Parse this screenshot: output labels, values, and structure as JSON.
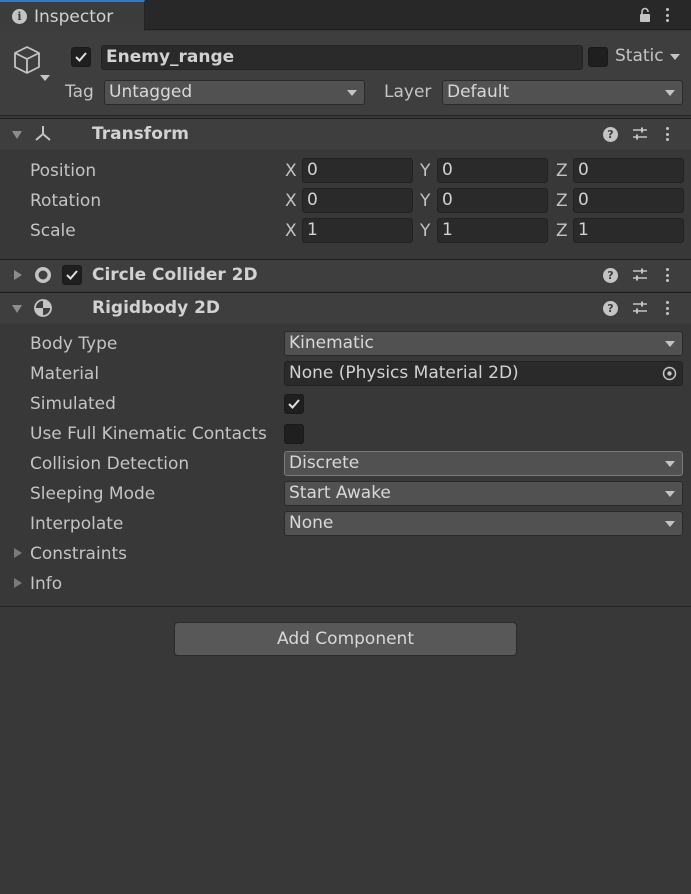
{
  "tab": {
    "title": "Inspector"
  },
  "gameobject": {
    "active": true,
    "name": "Enemy_range",
    "static_label": "Static",
    "tag_label": "Tag",
    "tag_value": "Untagged",
    "layer_label": "Layer",
    "layer_value": "Default"
  },
  "transform": {
    "title": "Transform",
    "rows": [
      {
        "label": "Position",
        "x": "0",
        "y": "0",
        "z": "0"
      },
      {
        "label": "Rotation",
        "x": "0",
        "y": "0",
        "z": "0"
      },
      {
        "label": "Scale",
        "x": "1",
        "y": "1",
        "z": "1"
      }
    ],
    "axis": {
      "x": "X",
      "y": "Y",
      "z": "Z"
    }
  },
  "circle_collider": {
    "title": "Circle Collider 2D",
    "enabled": true,
    "expanded": false
  },
  "rigidbody": {
    "title": "Rigidbody 2D",
    "body_type_label": "Body Type",
    "body_type_value": "Kinematic",
    "material_label": "Material",
    "material_value": "None (Physics Material 2D)",
    "simulated_label": "Simulated",
    "simulated": true,
    "full_kinematic_label": "Use Full Kinematic Contacts",
    "full_kinematic": false,
    "collision_label": "Collision Detection",
    "collision_value": "Discrete",
    "sleeping_label": "Sleeping Mode",
    "sleeping_value": "Start Awake",
    "interpolate_label": "Interpolate",
    "interpolate_value": "None",
    "constraints_label": "Constraints",
    "info_label": "Info"
  },
  "add_component": {
    "label": "Add Component"
  },
  "colors": {
    "accent": "#3a79bb",
    "background": "#383838",
    "header": "#3e3e3e"
  }
}
